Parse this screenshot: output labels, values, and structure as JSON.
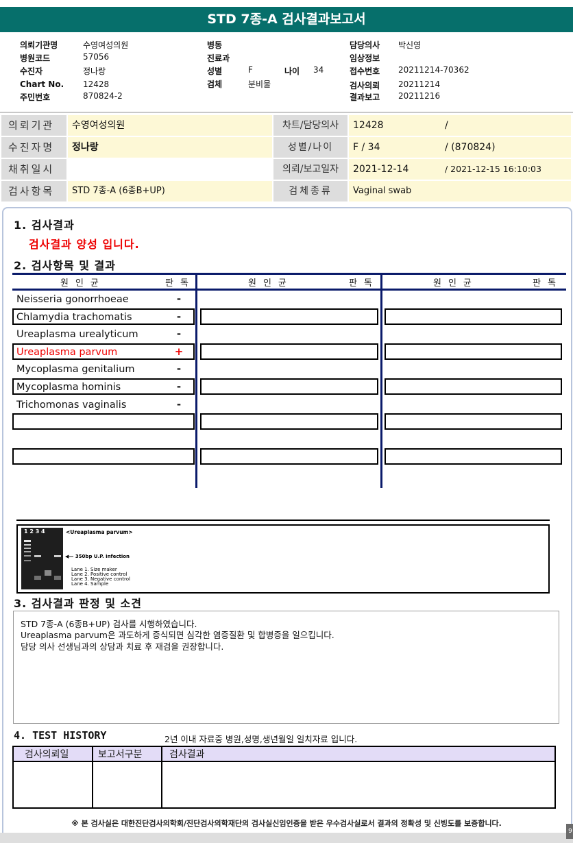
{
  "title": "STD 7종-A 검사결과보고서",
  "header": {
    "institution_label": "의뢰기관명",
    "institution": "수영여성의원",
    "hospital_code_label": "병원코드",
    "hospital_code": "57056",
    "patient_label": "수진자",
    "patient": "정나랑",
    "chart_label": "Chart No.",
    "chart": "12428",
    "resident_label": "주민번호",
    "resident": "870824-2",
    "ward_label": "병동",
    "dept_label": "진료과",
    "sex_label": "성별",
    "sex": "F",
    "age_label": "나이",
    "age": "34",
    "specimen_label": "검체",
    "specimen": "분비물",
    "doctor_label": "담당의사",
    "doctor": "박신영",
    "clinical_label": "임상정보",
    "receipt_label": "접수번호",
    "receipt": "20211214-70362",
    "request_label": "검사의뢰",
    "request": "20211214",
    "report_label": "결과보고",
    "report": "20211216"
  },
  "info": {
    "r1_label": "의뢰기관",
    "r1_value": "수영여성의원",
    "r1_label2": "차트/담당의사",
    "r1_value2": "12428",
    "r1_value2b": "/",
    "r2_label": "수진자명",
    "r2_value": "정나랑",
    "r2_label2": "성별/나이",
    "r2_value2": "F   /   34",
    "r2_value2b": "/ (870824)",
    "r3_label": "채취일시",
    "r3_value": "",
    "r3_label2": "의뢰/보고일자",
    "r3_value2": "2021-12-14",
    "r3_value2b": "/ 2021-12-15 16:10:03",
    "r4_label": "검사항목",
    "r4_value": "STD 7종-A (6종B+UP)",
    "r4_label2": "검체종류",
    "r4_value2": "Vaginal swab"
  },
  "sections": {
    "s1": "1. 검사결과",
    "positive": "검사결과 양성 입니다.",
    "s2": "2. 검사항목 및 결과",
    "s3": "3. 검사결과 판정 및 소견",
    "s4": "4. TEST HISTORY",
    "s4_note": "2년 이내 자료중 병원,성명,생년월일 일치자료 입니다."
  },
  "table_header": {
    "organism": "원인균",
    "result": "판독"
  },
  "pathogens": [
    {
      "name": "Neisseria gonorrhoeae",
      "result": "-"
    },
    {
      "name": "Chlamydia trachomatis",
      "result": "-"
    },
    {
      "name": "Ureaplasma urealyticum",
      "result": "-"
    },
    {
      "name": "Ureaplasma parvum",
      "result": "+"
    },
    {
      "name": "Mycoplasma genitalium",
      "result": "-"
    },
    {
      "name": "Mycoplasma hominis",
      "result": "-"
    },
    {
      "name": "Trichomonas vaginalis",
      "result": "-"
    }
  ],
  "gel": {
    "lanes": "1  2  3  4",
    "title": "<Ureaplasma parvum>",
    "band": "◀— 350bp U.P. infection",
    "legend1": "Lane 1. Size maker",
    "legend2": "Lane 2. Positive control",
    "legend3": "Lane 3. Negative control",
    "legend4": "Lane 4. Sample"
  },
  "opinion": [
    "STD 7종-A (6종B+UP) 검사를 시행하였습니다.",
    "Ureaplasma parvum은  과도하게 증식되면 심각한 염증질환 및 합병증을 일으킵니다.",
    "담당 의사 선생님과의 상담과 치료 후 재검을 권장합니다."
  ],
  "history_cols": [
    "검사의뢰일",
    "보고서구분",
    "검사결과"
  ],
  "footer": "※ 본 검사실은 대한진단검사의학회/진단검사의학재단의 검사실신임인증을 받은 우수검사실로서 결과의 정확성 및 신빙도를 보증합니다.",
  "page_number": "9",
  "colors": {
    "title_bar": "#066f6b",
    "positive": "#e00000",
    "info_value_bg": "#fdf8d6",
    "history_head": "#e3dcf7"
  }
}
